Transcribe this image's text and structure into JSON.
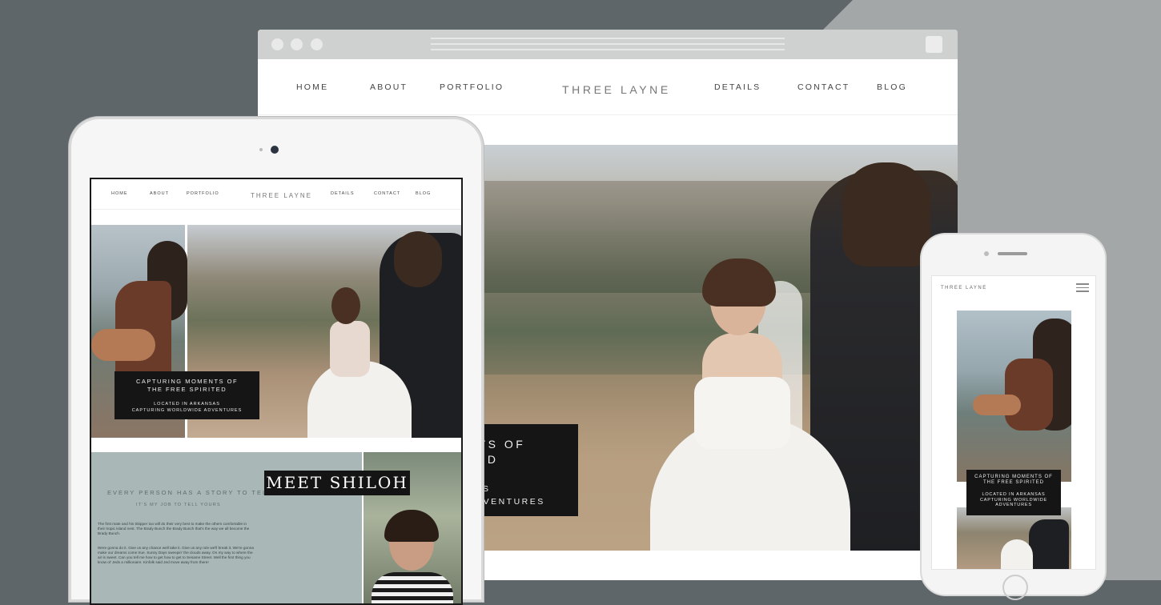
{
  "desktop": {
    "nav_left": [
      "HOME",
      "ABOUT",
      "PORTFOLIO"
    ],
    "brand": "THREE LAYNE",
    "nav_right": [
      "DETAILS",
      "CONTACT",
      "BLOG"
    ],
    "caption_line1": "NTS OF",
    "caption_line2": "TED",
    "caption_line3": "SAS",
    "caption_line4": "ADVENTURES"
  },
  "tablet": {
    "nav_left": [
      "HOME",
      "ABOUT",
      "PORTFOLIO"
    ],
    "brand": "THREE LAYNE",
    "nav_right": [
      "DETAILS",
      "CONTACT",
      "BLOG"
    ],
    "caption_title_1": "CAPTURING MOMENTS OF",
    "caption_title_2": "THE FREE SPIRITED",
    "caption_sub_1": "LOCATED IN ARKANSAS",
    "caption_sub_2": "CAPTURING WORLDWIDE ADVENTURES",
    "meet_heading": "MEET SHILOH",
    "about_heading": "EVERY PERSON HAS A STORY TO TELL",
    "about_subheading": "IT'S MY JOB TO TELL YOURS",
    "about_paragraph_1": "The first mate and his Skipper too will do their very best to make the others comfortable in their tropic island nest. The Brady Bunch the Brady Bunch that's the way we all become the Brady Bunch.",
    "about_paragraph_2": "Were gonna do it. Give us any chance well take it. Give us any rule we'll break it. We're gonna make our dreams come true. Sunny Days sweepin' the clouds away. On my way to where the air is sweet. Can you tell me how to get how to get to Sesame Street. Well the first thing you know ol' Jeds a millionaire. Kinfolk said Jed move away from there!"
  },
  "phone": {
    "brand": "THREE LAYNE",
    "caption_title_1": "CAPTURING MOMENTS OF",
    "caption_title_2": "THE FREE SPIRITED",
    "caption_sub_1": "LOCATED IN ARKANSAS",
    "caption_sub_2": "CAPTURING WORLDWIDE",
    "caption_sub_3": "ADVENTURES"
  },
  "icons": [
    "window-dot-icon",
    "menu-icon",
    "camera-icon",
    "home-button-icon"
  ],
  "colors": {
    "background_dark": "#5e6669",
    "background_light": "#a3a7a8",
    "caption_bg": "#151515",
    "about_bg": "#a9b8b7"
  }
}
